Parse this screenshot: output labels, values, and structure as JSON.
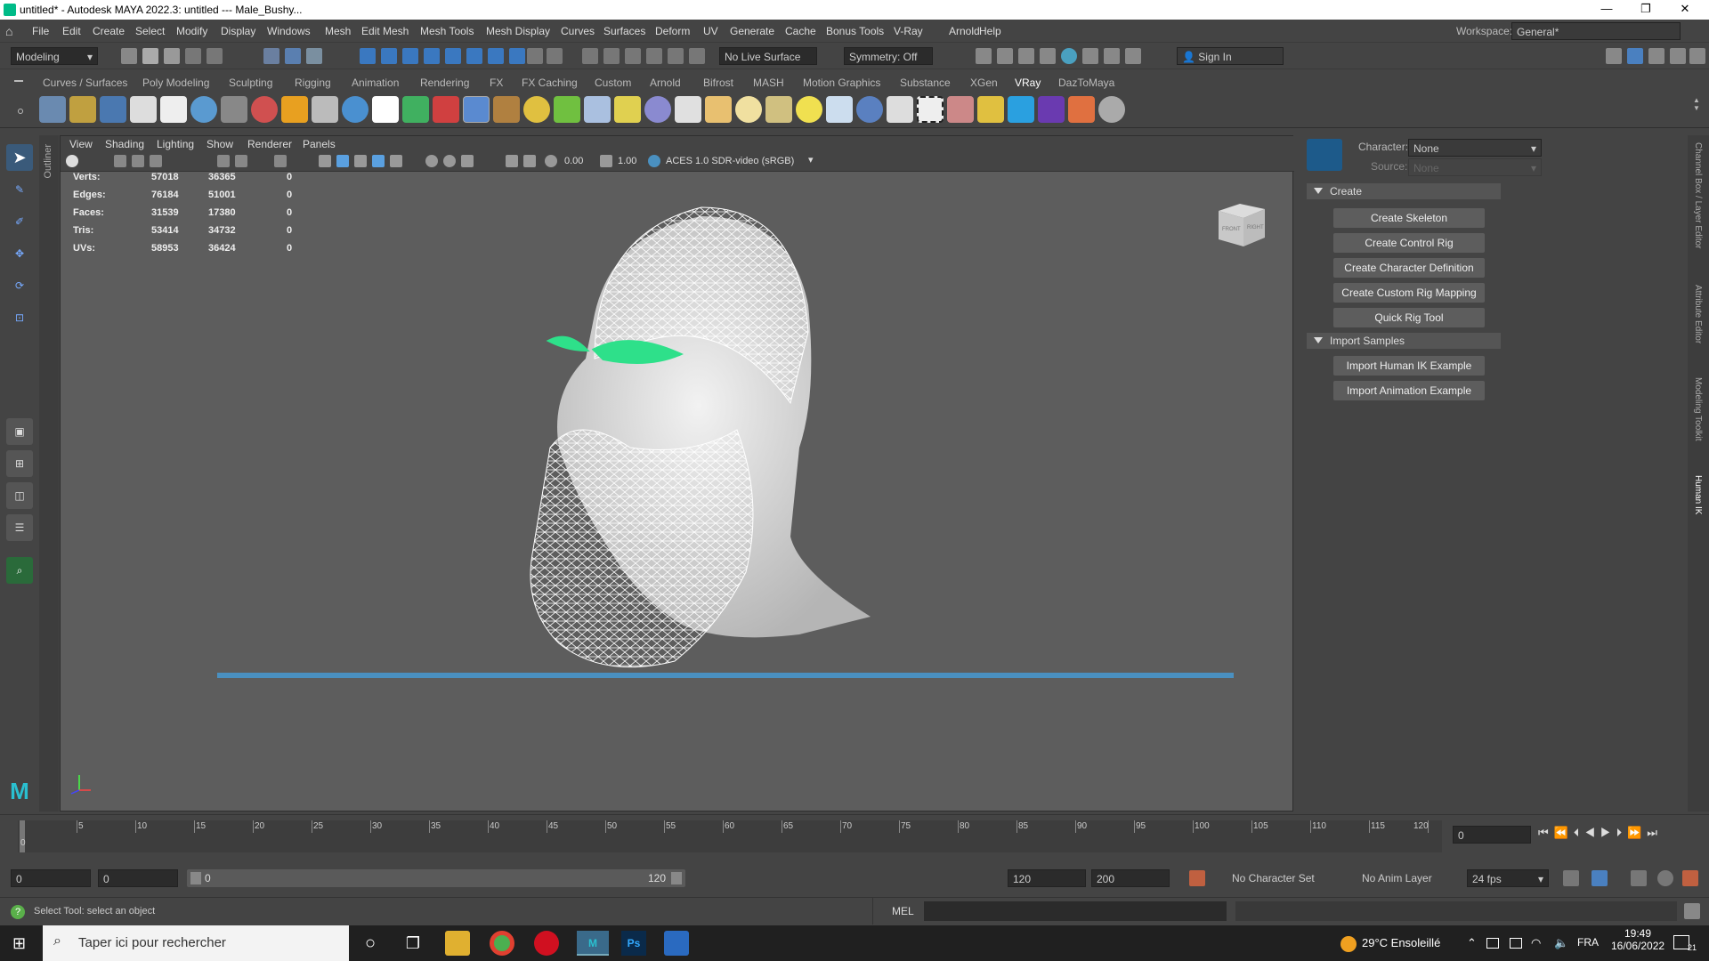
{
  "window": {
    "title": "untitled* - Autodesk MAYA 2022.3: untitled  ---  Male_Bushy..."
  },
  "menu": [
    "File",
    "Edit",
    "Create",
    "Select",
    "Modify",
    "Display",
    "Windows",
    "Mesh",
    "Edit Mesh",
    "Mesh Tools",
    "Mesh Display",
    "Curves",
    "Surfaces",
    "Deform",
    "UV",
    "Generate",
    "Cache",
    "Bonus Tools",
    "V-Ray",
    "Arnold",
    "Help"
  ],
  "workspace": {
    "label": "Workspace:",
    "value": "General*"
  },
  "statusline": {
    "mode": "Modeling",
    "live_surface": "No Live Surface",
    "symmetry": "Symmetry: Off",
    "signin": "Sign In"
  },
  "shelf_tabs": [
    "Curves / Surfaces",
    "Poly Modeling",
    "Sculpting",
    "Rigging",
    "Animation",
    "Rendering",
    "FX",
    "FX Caching",
    "Custom",
    "Arnold",
    "Bifrost",
    "MASH",
    "Motion Graphics",
    "Substance",
    "XGen",
    "VRay",
    "DazToMaya"
  ],
  "shelf_active": "VRay",
  "viewport": {
    "menu": [
      "View",
      "Shading",
      "Lighting",
      "Show",
      "Renderer",
      "Panels"
    ],
    "exposure": "0.00",
    "gamma": "1.00",
    "colorspace": "ACES 1.0 SDR-video (sRGB)",
    "hud": [
      {
        "label": "Verts:",
        "a": "57018",
        "b": "36365",
        "c": "0"
      },
      {
        "label": "Edges:",
        "a": "76184",
        "b": "51001",
        "c": "0"
      },
      {
        "label": "Faces:",
        "a": "31539",
        "b": "17380",
        "c": "0"
      },
      {
        "label": "Tris:",
        "a": "53414",
        "b": "34732",
        "c": "0"
      },
      {
        "label": "UVs:",
        "a": "58953",
        "b": "36424",
        "c": "0"
      }
    ],
    "viewcube": {
      "front": "FRONT",
      "right": "RIGHT"
    },
    "outliner_tab": "Outliner"
  },
  "humanik": {
    "character_label": "Character:",
    "character_value": "None",
    "source_label": "Source:",
    "source_value": "None",
    "sections": [
      {
        "title": "Create",
        "buttons": [
          "Create Skeleton",
          "Create Control Rig",
          "Create Character Definition",
          "Create Custom Rig Mapping",
          "Quick Rig Tool"
        ]
      },
      {
        "title": "Import Samples",
        "buttons": [
          "Import Human IK Example",
          "Import Animation Example"
        ]
      }
    ]
  },
  "side_tabs": [
    "Channel Box / Layer Editor",
    "Attribute Editor",
    "Modeling Toolkit",
    "Human IK"
  ],
  "timeline": {
    "ticks": [
      "5",
      "10",
      "15",
      "20",
      "25",
      "30",
      "35",
      "40",
      "45",
      "50",
      "55",
      "60",
      "65",
      "70",
      "75",
      "80",
      "85",
      "90",
      "95",
      "100",
      "105",
      "110",
      "115",
      "120"
    ],
    "start_label": "0",
    "current_frame": "0"
  },
  "range": {
    "start": "0",
    "start2": "0",
    "slider_start": "0",
    "slider_end": "120",
    "end": "120",
    "end2": "200",
    "char_set": "No Character Set",
    "anim_layer": "No Anim Layer",
    "fps": "24 fps"
  },
  "command": {
    "help": "Select Tool: select an object",
    "lang": "MEL"
  },
  "taskbar": {
    "search": "Taper ici pour rechercher",
    "weather": "29°C Ensoleillé",
    "lang": "FRA",
    "time": "19:49",
    "date": "16/06/2022",
    "notif": "21"
  }
}
